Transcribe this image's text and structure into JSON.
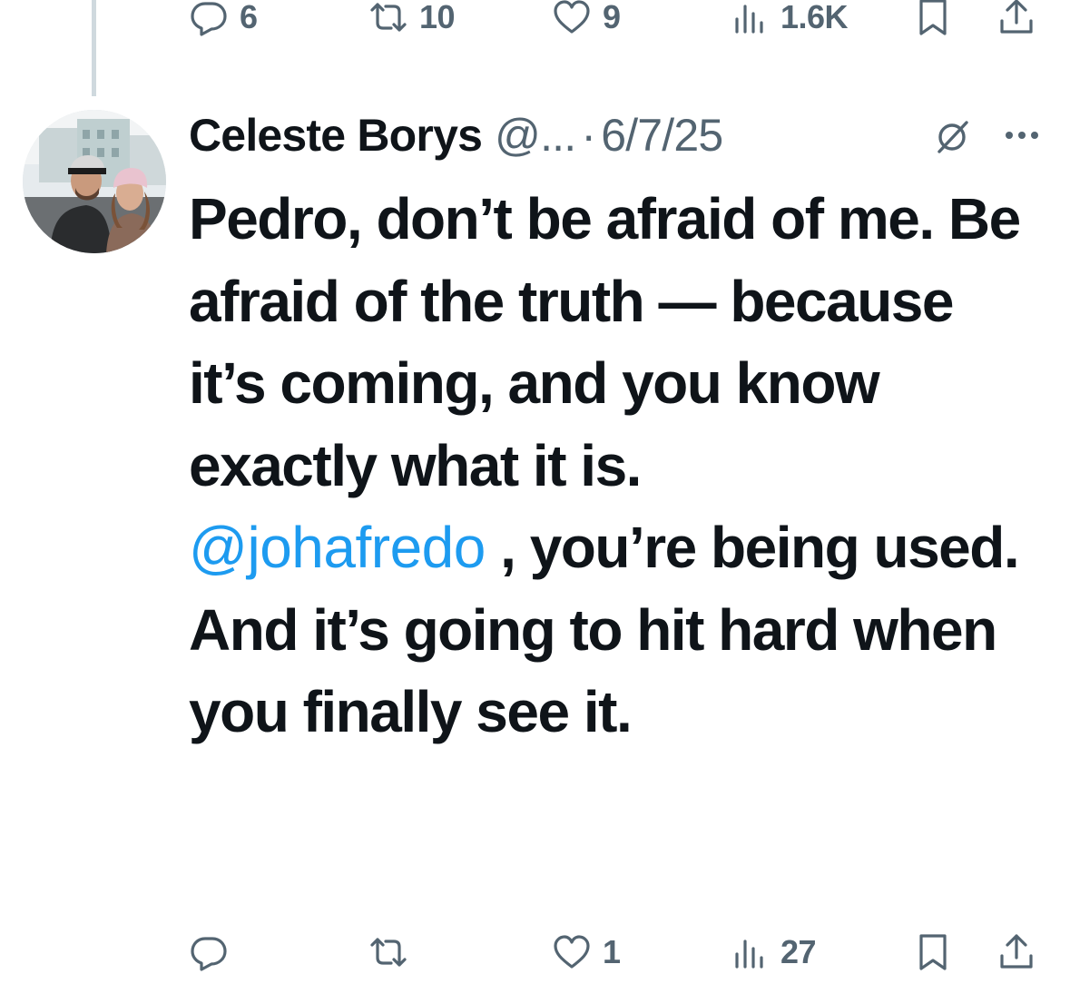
{
  "previous_tweet": {
    "actions": {
      "replies": "6",
      "reposts": "10",
      "likes": "9",
      "views": "1.6K"
    }
  },
  "tweet": {
    "author_name": "Celeste Borys",
    "author_handle": "@...",
    "separator": "·",
    "date": "6/7/25",
    "text_part1": "Pedro, don’t be afraid of me. Be afraid of the truth — because it’s coming, and you know exactly what it is.\n",
    "mention": "@johafredo",
    "text_part2": " , you’re being used. And it’s going to hit hard when you finally see it.",
    "actions": {
      "replies": "",
      "reposts": "",
      "likes": "1",
      "views": "27"
    }
  },
  "icons": {
    "reply": "reply-icon",
    "repost": "repost-icon",
    "like": "heart-icon",
    "views": "views-icon",
    "bookmark": "bookmark-icon",
    "share": "share-icon",
    "grok": "grok-icon",
    "more": "more-icon"
  },
  "colors": {
    "text": "#0f1419",
    "secondary": "#536471",
    "link": "#1d9bf0",
    "thread_line": "#cfd9de"
  }
}
